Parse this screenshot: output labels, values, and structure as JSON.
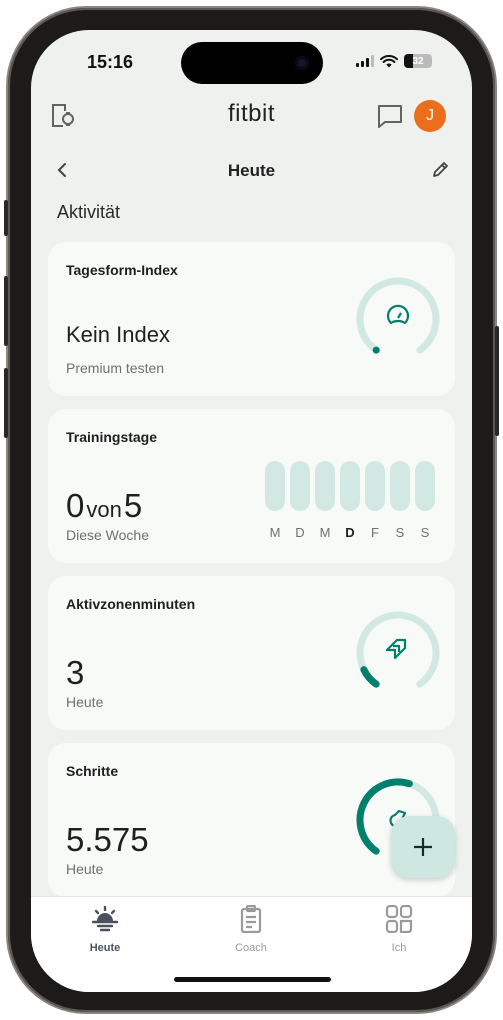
{
  "status_bar": {
    "time": "15:16",
    "battery": "32"
  },
  "app_bar": {
    "logo": "fitbit",
    "devices_icon": "devices-icon",
    "inbox_icon": "chat-bubble-icon",
    "avatar_initial": "J",
    "avatar_color": "#ec6e1c"
  },
  "sub_bar": {
    "title": "Heute",
    "back_icon": "chevron-left-icon",
    "edit_icon": "pencil-icon"
  },
  "section": {
    "title": "Aktivität"
  },
  "cards": {
    "readiness": {
      "label": "Tagesform-Index",
      "value": "Kein Index",
      "sub": "Premium testen",
      "icon": "speedometer-icon",
      "progress": 0
    },
    "training_days": {
      "label": "Trainingstage",
      "value": "0",
      "connector": "von",
      "goal": "5",
      "sub": "Diese Woche",
      "days": [
        "M",
        "D",
        "M",
        "D",
        "F",
        "S",
        "S"
      ],
      "today_index": 3,
      "completed": [
        false,
        false,
        false,
        false,
        false,
        false,
        false
      ]
    },
    "azm": {
      "label": "Aktivzonenminuten",
      "value": "3",
      "sub": "Heute",
      "icon": "active-zone-arrows-icon",
      "progress": 0.1
    },
    "steps": {
      "label": "Schritte",
      "value": "5.575",
      "sub": "Heute",
      "icon": "shoe-icon",
      "progress": 0.56
    }
  },
  "fab": {
    "icon": "plus-icon"
  },
  "tab_bar": {
    "tabs": [
      {
        "label": "Heute",
        "icon": "sunrise-icon",
        "active": true
      },
      {
        "label": "Coach",
        "icon": "clipboard-icon",
        "active": false
      },
      {
        "label": "Ich",
        "icon": "grid-icon",
        "active": false
      }
    ]
  },
  "colors": {
    "accent": "#00806c",
    "accent_light": "#d2e9e3",
    "background": "#eff1ef",
    "card": "#f8faf8"
  }
}
